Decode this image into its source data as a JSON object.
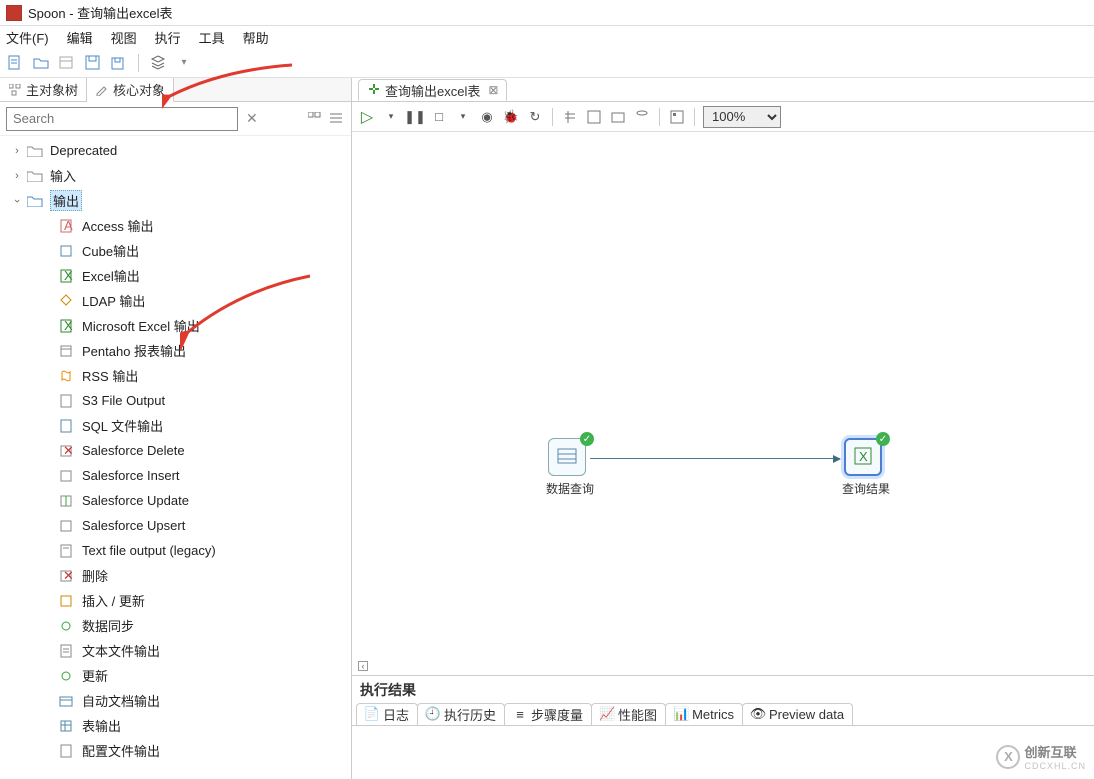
{
  "title": "Spoon - 查询输出excel表",
  "menu": [
    "文件(F)",
    "编辑",
    "视图",
    "执行",
    "工具",
    "帮助"
  ],
  "left_tabs": {
    "main": "主对象树",
    "core": "核心对象"
  },
  "search_placeholder": "Search",
  "tree": {
    "deprecated": "Deprecated",
    "input": "输入",
    "output": "输出",
    "items": [
      "Access 输出",
      "Cube输出",
      "Excel输出",
      "LDAP 输出",
      "Microsoft Excel 输出",
      "Pentaho 报表输出",
      "RSS 输出",
      "S3 File Output",
      "SQL 文件输出",
      "Salesforce Delete",
      "Salesforce Insert",
      "Salesforce Update",
      "Salesforce Upsert",
      "Text file output (legacy)",
      "删除",
      "插入 / 更新",
      "数据同步",
      "文本文件输出",
      "更新",
      "自动文档输出",
      "表输出",
      "配置文件输出"
    ]
  },
  "editor_tab": "查询输出excel表",
  "zoom": "100%",
  "nodes": {
    "query": "数据查询",
    "result": "查询结果"
  },
  "results": {
    "title": "执行结果",
    "tabs": [
      "日志",
      "执行历史",
      "步骤度量",
      "性能图",
      "Metrics",
      "Preview data"
    ]
  },
  "watermark": {
    "main": "创新互联",
    "sub": "CDCXHL.CN"
  }
}
